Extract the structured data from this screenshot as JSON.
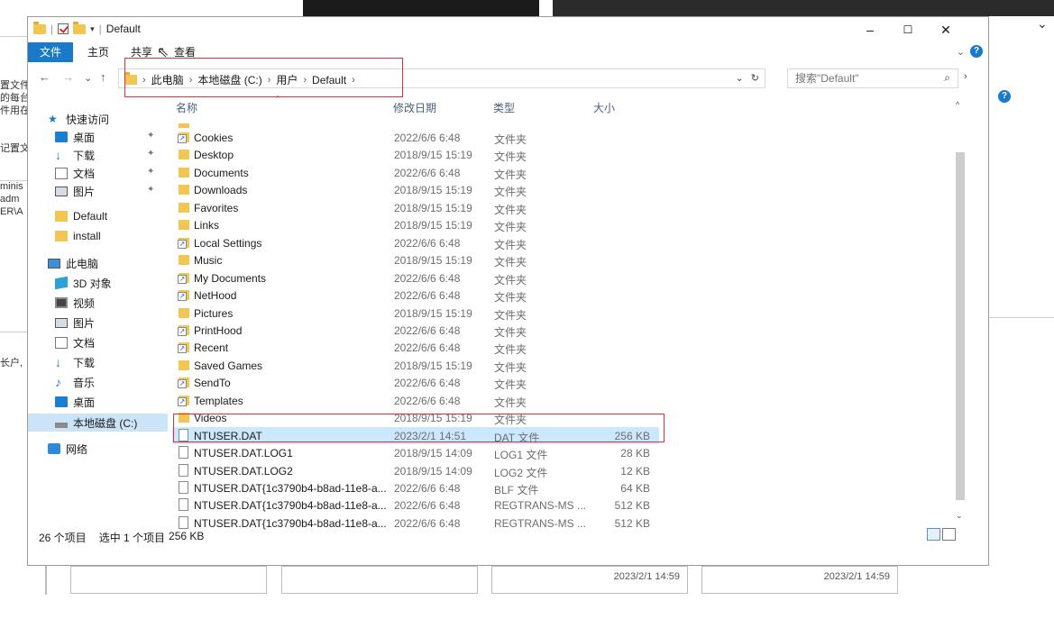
{
  "window": {
    "title": "Default",
    "controls": {
      "minimize": "–",
      "maximize": "☐",
      "close": "✕"
    }
  },
  "ribbon": {
    "tabs": [
      "文件",
      "主页",
      "共享",
      "查看"
    ],
    "right_chevron": "⌄",
    "help": "?"
  },
  "nav": {
    "back": "←",
    "forward": "→",
    "recent": "⌄",
    "up": "↑"
  },
  "address": {
    "breadcrumb": [
      "此电脑",
      "本地磁盘 (C:)",
      "用户",
      "Default"
    ],
    "separator": "›",
    "dropdown": "⌄",
    "refresh": "↻"
  },
  "search": {
    "placeholder": "搜索\"Default\"",
    "icon": "search-icon"
  },
  "navpane": {
    "quick_access": "快速访问",
    "pinned": [
      {
        "label": "桌面",
        "icon": "desktop-icon"
      },
      {
        "label": "下载",
        "icon": "download-icon"
      },
      {
        "label": "文档",
        "icon": "document-icon"
      },
      {
        "label": "图片",
        "icon": "pictures-icon"
      }
    ],
    "recent": [
      {
        "label": "Default",
        "icon": "folder-icon"
      },
      {
        "label": "install",
        "icon": "folder-icon"
      }
    ],
    "this_pc": "此电脑",
    "pc_items": [
      {
        "label": "3D 对象",
        "icon": "3d-objects-icon"
      },
      {
        "label": "视频",
        "icon": "video-icon"
      },
      {
        "label": "图片",
        "icon": "pictures-icon"
      },
      {
        "label": "文档",
        "icon": "document-icon"
      },
      {
        "label": "下载",
        "icon": "download-icon"
      },
      {
        "label": "音乐",
        "icon": "music-icon"
      },
      {
        "label": "桌面",
        "icon": "desktop-icon"
      },
      {
        "label": "本地磁盘 (C:)",
        "icon": "drive-icon"
      }
    ],
    "network": "网络"
  },
  "columns": {
    "name": "名称",
    "date": "修改日期",
    "type": "类型",
    "size": "大小"
  },
  "files": [
    {
      "name": "Cookies",
      "date": "2022/6/6 6:48",
      "type": "文件夹",
      "size": "",
      "icon": "shortcut-folder-icon"
    },
    {
      "name": "Desktop",
      "date": "2018/9/15 15:19",
      "type": "文件夹",
      "size": "",
      "icon": "folder-icon"
    },
    {
      "name": "Documents",
      "date": "2022/6/6 6:48",
      "type": "文件夹",
      "size": "",
      "icon": "folder-icon"
    },
    {
      "name": "Downloads",
      "date": "2018/9/15 15:19",
      "type": "文件夹",
      "size": "",
      "icon": "folder-icon"
    },
    {
      "name": "Favorites",
      "date": "2018/9/15 15:19",
      "type": "文件夹",
      "size": "",
      "icon": "folder-icon"
    },
    {
      "name": "Links",
      "date": "2018/9/15 15:19",
      "type": "文件夹",
      "size": "",
      "icon": "folder-icon"
    },
    {
      "name": "Local Settings",
      "date": "2022/6/6 6:48",
      "type": "文件夹",
      "size": "",
      "icon": "shortcut-folder-icon"
    },
    {
      "name": "Music",
      "date": "2018/9/15 15:19",
      "type": "文件夹",
      "size": "",
      "icon": "folder-icon"
    },
    {
      "name": "My Documents",
      "date": "2022/6/6 6:48",
      "type": "文件夹",
      "size": "",
      "icon": "shortcut-folder-icon"
    },
    {
      "name": "NetHood",
      "date": "2022/6/6 6:48",
      "type": "文件夹",
      "size": "",
      "icon": "shortcut-folder-icon"
    },
    {
      "name": "Pictures",
      "date": "2018/9/15 15:19",
      "type": "文件夹",
      "size": "",
      "icon": "folder-icon"
    },
    {
      "name": "PrintHood",
      "date": "2022/6/6 6:48",
      "type": "文件夹",
      "size": "",
      "icon": "shortcut-folder-icon"
    },
    {
      "name": "Recent",
      "date": "2022/6/6 6:48",
      "type": "文件夹",
      "size": "",
      "icon": "shortcut-folder-icon"
    },
    {
      "name": "Saved Games",
      "date": "2018/9/15 15:19",
      "type": "文件夹",
      "size": "",
      "icon": "folder-icon"
    },
    {
      "name": "SendTo",
      "date": "2022/6/6 6:48",
      "type": "文件夹",
      "size": "",
      "icon": "shortcut-folder-icon"
    },
    {
      "name": "Templates",
      "date": "2022/6/6 6:48",
      "type": "文件夹",
      "size": "",
      "icon": "shortcut-folder-icon"
    },
    {
      "name": "Videos",
      "date": "2018/9/15 15:19",
      "type": "文件夹",
      "size": "",
      "icon": "folder-icon"
    },
    {
      "name": "NTUSER.DAT",
      "date": "2023/2/1 14:51",
      "type": "DAT 文件",
      "size": "256 KB",
      "icon": "file-icon",
      "selected": true
    },
    {
      "name": "NTUSER.DAT.LOG1",
      "date": "2018/9/15 14:09",
      "type": "LOG1 文件",
      "size": "28 KB",
      "icon": "file-icon"
    },
    {
      "name": "NTUSER.DAT.LOG2",
      "date": "2018/9/15 14:09",
      "type": "LOG2 文件",
      "size": "12 KB",
      "icon": "file-icon"
    },
    {
      "name": "NTUSER.DAT{1c3790b4-b8ad-11e8-a...",
      "date": "2022/6/6 6:48",
      "type": "BLF 文件",
      "size": "64 KB",
      "icon": "file-icon"
    },
    {
      "name": "NTUSER.DAT{1c3790b4-b8ad-11e8-a...",
      "date": "2022/6/6 6:48",
      "type": "REGTRANS-MS ...",
      "size": "512 KB",
      "icon": "file-icon"
    },
    {
      "name": "NTUSER.DAT{1c3790b4-b8ad-11e8-a...",
      "date": "2022/6/6 6:48",
      "type": "REGTRANS-MS ...",
      "size": "512 KB",
      "icon": "file-icon"
    }
  ],
  "status": {
    "count": "26 个项目",
    "selection": "选中 1 个项目",
    "size": "256 KB"
  },
  "background": {
    "left_fragments": [
      "置文件",
      "的每台",
      "件用在",
      "",
      "",
      "记置文",
      "",
      "",
      "minis",
      "adm",
      "ER\\A",
      "",
      "",
      "",
      "",
      "",
      "",
      "",
      "",
      "",
      "",
      "",
      "长户,"
    ],
    "box_times": [
      "2023/2/1 14:59",
      "2023/2/1 14:59"
    ],
    "right_s": "s"
  },
  "colors": {
    "accent": "#1979ca",
    "highlight_box": "#d4333a",
    "selection": "#cce8ff"
  }
}
